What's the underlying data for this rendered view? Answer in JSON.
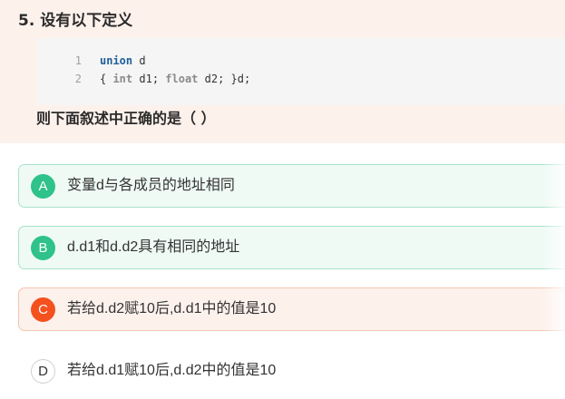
{
  "question": {
    "title": "5. 设有以下定义",
    "code": [
      {
        "line_no": "1",
        "keyword": "union",
        "rest": " d"
      },
      {
        "line_no": "2",
        "prefix": "{ ",
        "type1": "int",
        "mid": " d1; ",
        "type2": "float",
        "suffix": " d2; }d;"
      }
    ],
    "prompt": "则下面叙述中正确的是（ ）"
  },
  "options": [
    {
      "letter": "A",
      "text": "变量d与各成员的地址相同",
      "state": "correct"
    },
    {
      "letter": "B",
      "text": "d.d1和d.d2具有相同的地址",
      "state": "correct"
    },
    {
      "letter": "C",
      "text": "若给d.d2赋10后,d.d1中的值是10",
      "state": "wrong"
    },
    {
      "letter": "D",
      "text": "若给d.d1赋10后,d.d2中的值是10",
      "state": "neutral"
    }
  ],
  "colors": {
    "correct_badge": "#2fc28a",
    "wrong_badge": "#f4511e",
    "question_bg": "#fdf1ec",
    "code_keyword": "#1f5f9a"
  }
}
